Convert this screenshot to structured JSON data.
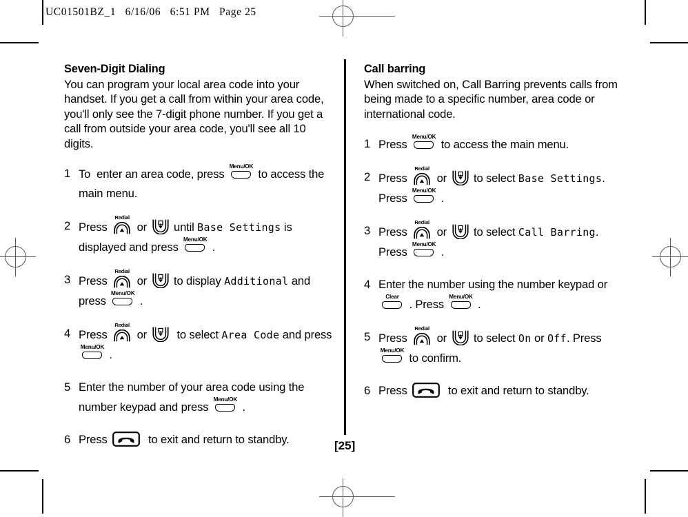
{
  "page": {
    "slug": "UC01501BZ_1   6/16/06   6:51 PM   Page 25",
    "folio": "[25]"
  },
  "left_column": {
    "title": "Seven-Digit Dialing",
    "intro": "You can program your local area code into your handset. If you get a call from within your area code, you'll only see the 7-digit phone number. If you get a call from outside your area code, you'll see all 10 digits.",
    "steps": [
      {
        "num": "1",
        "parts": [
          {
            "type": "text",
            "value": "To  enter an area code, press "
          },
          {
            "type": "key",
            "key": "menu-ok",
            "label": "Menu/OK"
          },
          {
            "type": "text",
            "value": " to access the main menu."
          }
        ]
      },
      {
        "num": "2",
        "parts": [
          {
            "type": "text",
            "value": "Press "
          },
          {
            "type": "key",
            "key": "redial-up",
            "label": "Redial"
          },
          {
            "type": "text",
            "value": " or "
          },
          {
            "type": "key",
            "key": "down",
            "label": ""
          },
          {
            "type": "text",
            "value": " until "
          },
          {
            "type": "lcd",
            "value": "Base Settings"
          },
          {
            "type": "text",
            "value": " is displayed and press "
          },
          {
            "type": "key",
            "key": "menu-ok",
            "label": "Menu/OK"
          },
          {
            "type": "text",
            "value": " ."
          }
        ]
      },
      {
        "num": "3",
        "parts": [
          {
            "type": "text",
            "value": "Press "
          },
          {
            "type": "key",
            "key": "redial-up",
            "label": "Redial"
          },
          {
            "type": "text",
            "value": " or "
          },
          {
            "type": "key",
            "key": "down",
            "label": ""
          },
          {
            "type": "text",
            "value": " to display "
          },
          {
            "type": "lcd",
            "value": "Additional"
          },
          {
            "type": "text",
            "value": " and press "
          },
          {
            "type": "key",
            "key": "menu-ok",
            "label": "Menu/OK"
          },
          {
            "type": "text",
            "value": " ."
          }
        ]
      },
      {
        "num": "4",
        "parts": [
          {
            "type": "text",
            "value": "Press "
          },
          {
            "type": "key",
            "key": "redial-up",
            "label": "Redial"
          },
          {
            "type": "text",
            "value": " or "
          },
          {
            "type": "key",
            "key": "down",
            "label": ""
          },
          {
            "type": "text",
            "value": "  to select "
          },
          {
            "type": "lcd",
            "value": "Area Code"
          },
          {
            "type": "text",
            "value": " and press "
          },
          {
            "type": "key",
            "key": "menu-ok",
            "label": "Menu/OK"
          },
          {
            "type": "text",
            "value": " ."
          }
        ]
      },
      {
        "num": "5",
        "parts": [
          {
            "type": "text",
            "value": "Enter the number of your area code using the number keypad and press "
          },
          {
            "type": "key",
            "key": "menu-ok",
            "label": "Menu/OK"
          },
          {
            "type": "text",
            "value": " ."
          }
        ]
      },
      {
        "num": "6",
        "parts": [
          {
            "type": "text",
            "value": "Press "
          },
          {
            "type": "key",
            "key": "end-call",
            "label": ""
          },
          {
            "type": "text",
            "value": "  to exit and return to standby."
          }
        ]
      }
    ]
  },
  "right_column": {
    "title": "Call barring",
    "intro": "When switched on, Call Barring prevents calls from being made to a specific number, area code or international code.",
    "steps": [
      {
        "num": "1",
        "parts": [
          {
            "type": "text",
            "value": "Press "
          },
          {
            "type": "key",
            "key": "menu-ok",
            "label": "Menu/OK"
          },
          {
            "type": "text",
            "value": " to access the main menu."
          }
        ]
      },
      {
        "num": "2",
        "parts": [
          {
            "type": "text",
            "value": "Press "
          },
          {
            "type": "key",
            "key": "redial-up",
            "label": "Redial"
          },
          {
            "type": "text",
            "value": " or "
          },
          {
            "type": "key",
            "key": "down",
            "label": ""
          },
          {
            "type": "text",
            "value": " to select "
          },
          {
            "type": "lcd",
            "value": "Base Settings"
          },
          {
            "type": "text",
            "value": ". Press "
          },
          {
            "type": "key",
            "key": "menu-ok",
            "label": "Menu/OK"
          },
          {
            "type": "text",
            "value": " ."
          }
        ]
      },
      {
        "num": "3",
        "parts": [
          {
            "type": "text",
            "value": "Press "
          },
          {
            "type": "key",
            "key": "redial-up",
            "label": "Redial"
          },
          {
            "type": "text",
            "value": " or "
          },
          {
            "type": "key",
            "key": "down",
            "label": ""
          },
          {
            "type": "text",
            "value": " to select "
          },
          {
            "type": "lcd",
            "value": "Call Barring"
          },
          {
            "type": "text",
            "value": ". Press "
          },
          {
            "type": "key",
            "key": "menu-ok",
            "label": "Menu/OK"
          },
          {
            "type": "text",
            "value": " ."
          }
        ]
      },
      {
        "num": "4",
        "parts": [
          {
            "type": "text",
            "value": "Enter the number using the number keypad or "
          },
          {
            "type": "key",
            "key": "clear",
            "label": "Clear"
          },
          {
            "type": "text",
            "value": " . Press "
          },
          {
            "type": "key",
            "key": "menu-ok",
            "label": "Menu/OK"
          },
          {
            "type": "text",
            "value": " ."
          }
        ]
      },
      {
        "num": "5",
        "parts": [
          {
            "type": "text",
            "value": "Press "
          },
          {
            "type": "key",
            "key": "redial-up",
            "label": "Redial"
          },
          {
            "type": "text",
            "value": " or "
          },
          {
            "type": "key",
            "key": "down",
            "label": ""
          },
          {
            "type": "text",
            "value": " to select "
          },
          {
            "type": "lcd",
            "value": "On"
          },
          {
            "type": "text",
            "value": " or "
          },
          {
            "type": "lcd",
            "value": "Off"
          },
          {
            "type": "text",
            "value": ". Press "
          },
          {
            "type": "key",
            "key": "menu-ok",
            "label": "Menu/OK"
          },
          {
            "type": "text",
            "value": " to confirm."
          }
        ]
      },
      {
        "num": "6",
        "parts": [
          {
            "type": "text",
            "value": "Press "
          },
          {
            "type": "key",
            "key": "end-call",
            "label": ""
          },
          {
            "type": "text",
            "value": "  to exit and return to standby."
          }
        ]
      }
    ]
  },
  "colors": {
    "ink": "#000000",
    "registration": "#5a5a5a",
    "paper": "#ffffff"
  }
}
